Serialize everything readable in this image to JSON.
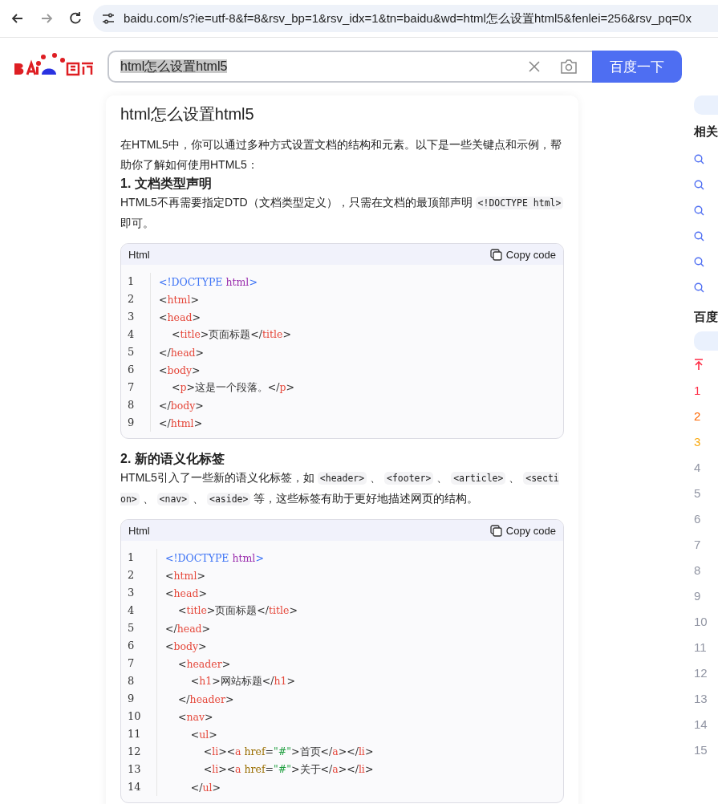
{
  "browser": {
    "url": "baidu.com/s?ie=utf-8&f=8&rsv_bp=1&rsv_idx=1&tn=baidu&wd=html怎么设置html5&fenlei=256&rsv_pq=0x"
  },
  "search": {
    "value": "html怎么设置html5",
    "button": "百度一下"
  },
  "answer": {
    "title": "html怎么设置html5",
    "blocks": [
      {
        "kind": "para",
        "segments": [
          {
            "kind": "text",
            "text": "在HTML5中，你可以通过多种方式设置文档的结构和元素。以下是一些关键点和示例，帮助你了解如何使用HTML5："
          }
        ]
      },
      {
        "kind": "heading",
        "text": "1. 文档类型声明"
      },
      {
        "kind": "para",
        "segments": [
          {
            "kind": "text",
            "text": "HTML5不再需要指定DTD（文档类型定义），只需在文档的最顶部声明 "
          },
          {
            "kind": "code",
            "text": "<!DOCTYPE html>"
          },
          {
            "kind": "text",
            "text": " 即可。"
          }
        ]
      },
      {
        "kind": "code",
        "language": "Html",
        "copy": "Copy code",
        "lines": [
          {
            "number": "1",
            "tokens": [
              {
                "kind": "doctype",
                "text": "<!DOCTYPE "
              },
              {
                "kind": "keyword",
                "text": "html"
              },
              {
                "kind": "doctype",
                "text": ">"
              }
            ]
          },
          {
            "number": "2",
            "tokens": [
              {
                "kind": "punct",
                "text": "<"
              },
              {
                "kind": "tag",
                "text": "html"
              },
              {
                "kind": "punct",
                "text": ">"
              }
            ]
          },
          {
            "number": "3",
            "tokens": [
              {
                "kind": "punct",
                "text": "<"
              },
              {
                "kind": "tag",
                "text": "head"
              },
              {
                "kind": "punct",
                "text": ">"
              }
            ]
          },
          {
            "number": "4",
            "tokens": [
              {
                "kind": "punct",
                "text": "    <"
              },
              {
                "kind": "tag",
                "text": "title"
              },
              {
                "kind": "punct",
                "text": ">页面标题</"
              },
              {
                "kind": "tag",
                "text": "title"
              },
              {
                "kind": "punct",
                "text": ">"
              }
            ]
          },
          {
            "number": "5",
            "tokens": [
              {
                "kind": "punct",
                "text": "</"
              },
              {
                "kind": "tag",
                "text": "head"
              },
              {
                "kind": "punct",
                "text": ">"
              }
            ]
          },
          {
            "number": "6",
            "tokens": [
              {
                "kind": "punct",
                "text": "<"
              },
              {
                "kind": "tag",
                "text": "body"
              },
              {
                "kind": "punct",
                "text": ">"
              }
            ]
          },
          {
            "number": "7",
            "tokens": [
              {
                "kind": "punct",
                "text": "    <"
              },
              {
                "kind": "tag",
                "text": "p"
              },
              {
                "kind": "punct",
                "text": ">这是一个段落。</"
              },
              {
                "kind": "tag",
                "text": "p"
              },
              {
                "kind": "punct",
                "text": ">"
              }
            ]
          },
          {
            "number": "8",
            "tokens": [
              {
                "kind": "punct",
                "text": "</"
              },
              {
                "kind": "tag",
                "text": "body"
              },
              {
                "kind": "punct",
                "text": ">"
              }
            ]
          },
          {
            "number": "9",
            "tokens": [
              {
                "kind": "punct",
                "text": "</"
              },
              {
                "kind": "tag",
                "text": "html"
              },
              {
                "kind": "punct",
                "text": ">"
              }
            ]
          }
        ]
      },
      {
        "kind": "heading",
        "text": "2. 新的语义化标签"
      },
      {
        "kind": "para",
        "segments": [
          {
            "kind": "text",
            "text": "HTML5引入了一些新的语义化标签，如 "
          },
          {
            "kind": "code",
            "text": "<header>"
          },
          {
            "kind": "text",
            "text": " 、 "
          },
          {
            "kind": "code",
            "text": "<footer>"
          },
          {
            "kind": "text",
            "text": " 、 "
          },
          {
            "kind": "code",
            "text": "<article>"
          },
          {
            "kind": "text",
            "text": " 、 "
          },
          {
            "kind": "code",
            "text": "<section>"
          },
          {
            "kind": "text",
            "text": " 、 "
          },
          {
            "kind": "code",
            "text": "<nav>"
          },
          {
            "kind": "text",
            "text": " 、 "
          },
          {
            "kind": "code",
            "text": "<aside>"
          },
          {
            "kind": "text",
            "text": " 等，这些标签有助于更好地描述网页的结构。"
          }
        ]
      },
      {
        "kind": "code",
        "language": "Html",
        "copy": "Copy code",
        "lines": [
          {
            "number": "1",
            "tokens": [
              {
                "kind": "doctype",
                "text": "<!DOCTYPE "
              },
              {
                "kind": "keyword",
                "text": "html"
              },
              {
                "kind": "doctype",
                "text": ">"
              }
            ]
          },
          {
            "number": "2",
            "tokens": [
              {
                "kind": "punct",
                "text": "<"
              },
              {
                "kind": "tag",
                "text": "html"
              },
              {
                "kind": "punct",
                "text": ">"
              }
            ]
          },
          {
            "number": "3",
            "tokens": [
              {
                "kind": "punct",
                "text": "<"
              },
              {
                "kind": "tag",
                "text": "head"
              },
              {
                "kind": "punct",
                "text": ">"
              }
            ]
          },
          {
            "number": "4",
            "tokens": [
              {
                "kind": "punct",
                "text": "    <"
              },
              {
                "kind": "tag",
                "text": "title"
              },
              {
                "kind": "punct",
                "text": ">页面标题</"
              },
              {
                "kind": "tag",
                "text": "title"
              },
              {
                "kind": "punct",
                "text": ">"
              }
            ]
          },
          {
            "number": "5",
            "tokens": [
              {
                "kind": "punct",
                "text": "</"
              },
              {
                "kind": "tag",
                "text": "head"
              },
              {
                "kind": "punct",
                "text": ">"
              }
            ]
          },
          {
            "number": "6",
            "tokens": [
              {
                "kind": "punct",
                "text": "<"
              },
              {
                "kind": "tag",
                "text": "body"
              },
              {
                "kind": "punct",
                "text": ">"
              }
            ]
          },
          {
            "number": "7",
            "tokens": [
              {
                "kind": "punct",
                "text": "    <"
              },
              {
                "kind": "tag",
                "text": "header"
              },
              {
                "kind": "punct",
                "text": ">"
              }
            ]
          },
          {
            "number": "8",
            "tokens": [
              {
                "kind": "punct",
                "text": "        <"
              },
              {
                "kind": "tag",
                "text": "h1"
              },
              {
                "kind": "punct",
                "text": ">网站标题</"
              },
              {
                "kind": "tag",
                "text": "h1"
              },
              {
                "kind": "punct",
                "text": ">"
              }
            ]
          },
          {
            "number": "9",
            "tokens": [
              {
                "kind": "punct",
                "text": "    </"
              },
              {
                "kind": "tag",
                "text": "header"
              },
              {
                "kind": "punct",
                "text": ">"
              }
            ]
          },
          {
            "number": "10",
            "tokens": [
              {
                "kind": "punct",
                "text": "    <"
              },
              {
                "kind": "tag",
                "text": "nav"
              },
              {
                "kind": "punct",
                "text": ">"
              }
            ]
          },
          {
            "number": "11",
            "tokens": [
              {
                "kind": "punct",
                "text": "        <"
              },
              {
                "kind": "tag",
                "text": "ul"
              },
              {
                "kind": "punct",
                "text": ">"
              }
            ]
          },
          {
            "number": "12",
            "tokens": [
              {
                "kind": "punct",
                "text": "            <"
              },
              {
                "kind": "tag",
                "text": "li"
              },
              {
                "kind": "punct",
                "text": "><"
              },
              {
                "kind": "tag",
                "text": "a "
              },
              {
                "kind": "attr",
                "text": "href"
              },
              {
                "kind": "punct",
                "text": "="
              },
              {
                "kind": "string",
                "text": "\"#\""
              },
              {
                "kind": "punct",
                "text": ">首页</"
              },
              {
                "kind": "tag",
                "text": "a"
              },
              {
                "kind": "punct",
                "text": "></"
              },
              {
                "kind": "tag",
                "text": "li"
              },
              {
                "kind": "punct",
                "text": ">"
              }
            ]
          },
          {
            "number": "13",
            "tokens": [
              {
                "kind": "punct",
                "text": "            <"
              },
              {
                "kind": "tag",
                "text": "li"
              },
              {
                "kind": "punct",
                "text": "><"
              },
              {
                "kind": "tag",
                "text": "a "
              },
              {
                "kind": "attr",
                "text": "href"
              },
              {
                "kind": "punct",
                "text": "="
              },
              {
                "kind": "string",
                "text": "\"#\""
              },
              {
                "kind": "punct",
                "text": ">关于</"
              },
              {
                "kind": "tag",
                "text": "a"
              },
              {
                "kind": "punct",
                "text": "></"
              },
              {
                "kind": "tag",
                "text": "li"
              },
              {
                "kind": "punct",
                "text": ">"
              }
            ]
          },
          {
            "number": "14",
            "tokens": [
              {
                "kind": "punct",
                "text": "        </"
              },
              {
                "kind": "tag",
                "text": "ul"
              },
              {
                "kind": "punct",
                "text": ">"
              }
            ]
          }
        ]
      }
    ]
  },
  "sidebar": {
    "related_heading": "相关",
    "hot_heading": "百度",
    "hot_ranks": [
      {
        "rank": "1",
        "color": "#fe2d46"
      },
      {
        "rank": "2",
        "color": "#ff6600"
      },
      {
        "rank": "3",
        "color": "#faa90e"
      },
      {
        "rank": "4",
        "color": "#9195a3"
      },
      {
        "rank": "5",
        "color": "#9195a3"
      },
      {
        "rank": "6",
        "color": "#9195a3"
      },
      {
        "rank": "7",
        "color": "#9195a3"
      },
      {
        "rank": "8",
        "color": "#9195a3"
      },
      {
        "rank": "9",
        "color": "#9195a3"
      },
      {
        "rank": "10",
        "color": "#9195a3"
      },
      {
        "rank": "11",
        "color": "#9195a3"
      },
      {
        "rank": "12",
        "color": "#9195a3"
      },
      {
        "rank": "13",
        "color": "#9195a3"
      },
      {
        "rank": "14",
        "color": "#9195a3"
      },
      {
        "rank": "15",
        "color": "#9195a3"
      }
    ]
  }
}
